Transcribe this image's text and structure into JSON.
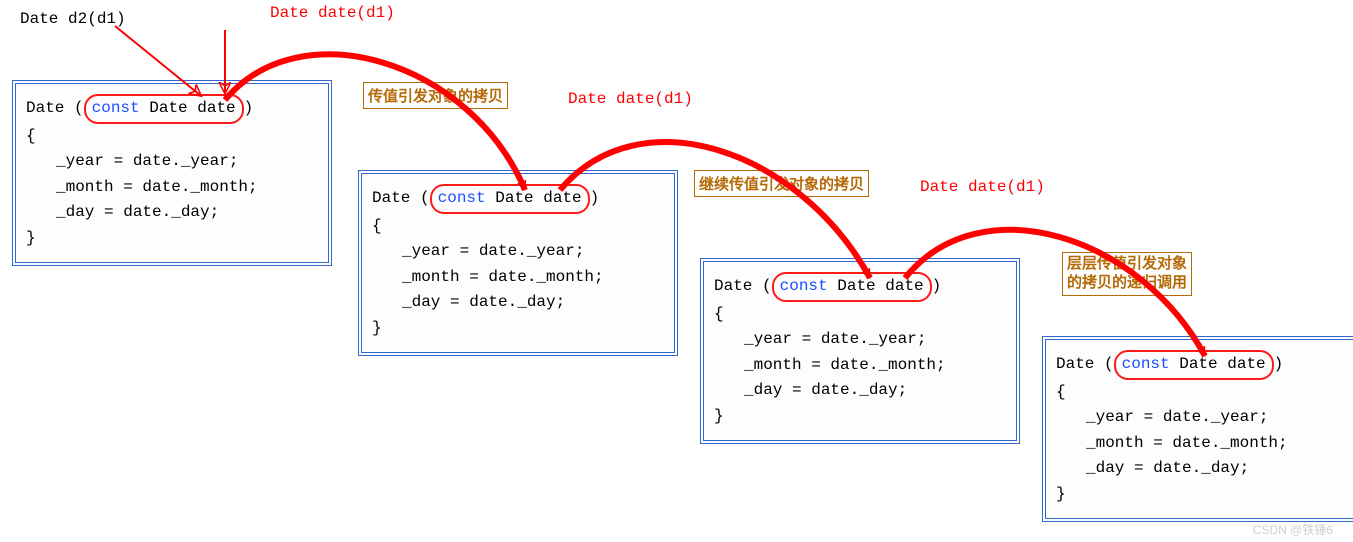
{
  "top_code": "Date d2(d1)",
  "labels": {
    "call1": "Date date(d1)",
    "call2": "Date date(d1)",
    "call3": "Date date(d1)",
    "note1": "传值引发对象的拷贝",
    "note2": "继续传值引发对象的拷贝",
    "note3_line1": "层层传值引发对象",
    "note3_line2": "的拷贝的递归调用"
  },
  "box": {
    "class": "Date",
    "kw": "const",
    "param_type": "Date",
    "param_name": "date",
    "body_year": "_year  = date._year;",
    "body_month": "_month = date._month;",
    "body_day": "_day   = date._day;"
  },
  "watermark": "CSDN @铁锤6"
}
